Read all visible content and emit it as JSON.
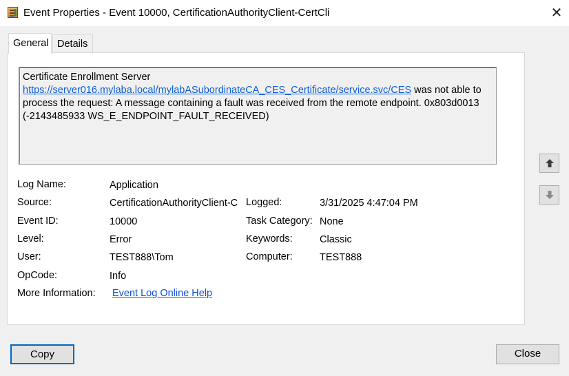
{
  "window": {
    "title": "Event Properties - Event 10000, CertificationAuthorityClient-CertCli",
    "close_glyph": "✕"
  },
  "tabs": [
    {
      "label": "General",
      "active": true
    },
    {
      "label": "Details",
      "active": false
    }
  ],
  "message": {
    "line1": "Certificate Enrollment Server",
    "url": "https://server016.mylaba.local/mylabASubordinateCA_CES_Certificate/service.svc/CES",
    "rest": " was not able to process the request: A message containing a fault was received from the remote endpoint. 0x803d0013 (-2143485933 WS_E_ENDPOINT_FAULT_RECEIVED)"
  },
  "fields": {
    "log_name": {
      "label": "Log Name:",
      "value": "Application"
    },
    "source": {
      "label": "Source:",
      "value": "CertificationAuthorityClient-CertCli"
    },
    "logged": {
      "label": "Logged:",
      "value": "3/31/2025 4:47:04 PM"
    },
    "event_id": {
      "label": "Event ID:",
      "value": "10000"
    },
    "task_category": {
      "label": "Task Category:",
      "value": "None"
    },
    "level": {
      "label": "Level:",
      "value": "Error"
    },
    "keywords": {
      "label": "Keywords:",
      "value": "Classic"
    },
    "user": {
      "label": "User:",
      "value": "TEST888\\Tom"
    },
    "computer": {
      "label": "Computer:",
      "value": "TEST888"
    },
    "opcode": {
      "label": "OpCode:",
      "value": "Info"
    },
    "more_info": {
      "label": "More Information:",
      "value": "Event Log Online Help"
    }
  },
  "nav": {
    "up_icon": "arrow-up-icon",
    "down_icon": "arrow-down-icon"
  },
  "buttons": {
    "copy": "Copy",
    "close": "Close"
  },
  "colors": {
    "link": "#0b4fd4",
    "focus_border": "#0067c0"
  }
}
